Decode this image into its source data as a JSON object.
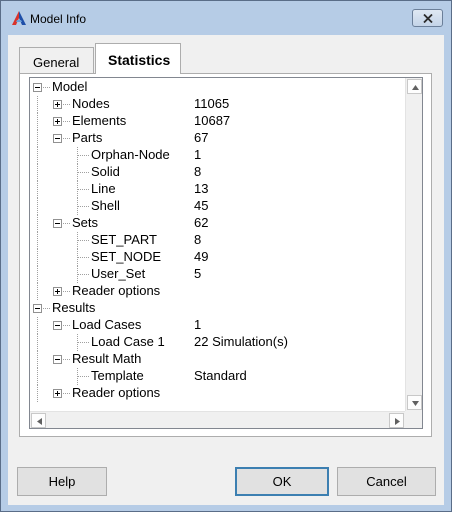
{
  "window": {
    "title": "Model Info",
    "icons": {
      "app": "altair-logo-icon",
      "close": "close-icon"
    }
  },
  "tabs": [
    {
      "label": "General",
      "selected": false
    },
    {
      "label": "Statistics",
      "selected": true
    }
  ],
  "tree": {
    "nodes": [
      {
        "id": "model",
        "label": "Model",
        "value": "",
        "depth": 0,
        "toggle": "minus"
      },
      {
        "id": "nodes",
        "label": "Nodes",
        "value": "11065",
        "depth": 1,
        "toggle": "plus"
      },
      {
        "id": "elements",
        "label": "Elements",
        "value": "10687",
        "depth": 1,
        "toggle": "plus"
      },
      {
        "id": "parts",
        "label": "Parts",
        "value": "67",
        "depth": 1,
        "toggle": "minus"
      },
      {
        "id": "orphan-node",
        "label": "Orphan-Node",
        "value": "1",
        "depth": 2,
        "toggle": "none"
      },
      {
        "id": "solid",
        "label": "Solid",
        "value": "8",
        "depth": 2,
        "toggle": "none"
      },
      {
        "id": "line",
        "label": "Line",
        "value": "13",
        "depth": 2,
        "toggle": "none"
      },
      {
        "id": "shell",
        "label": "Shell",
        "value": "45",
        "depth": 2,
        "toggle": "none"
      },
      {
        "id": "sets",
        "label": "Sets",
        "value": "62",
        "depth": 1,
        "toggle": "minus"
      },
      {
        "id": "set-part",
        "label": "SET_PART",
        "value": "8",
        "depth": 2,
        "toggle": "none"
      },
      {
        "id": "set-node",
        "label": "SET_NODE",
        "value": "49",
        "depth": 2,
        "toggle": "none"
      },
      {
        "id": "user-set",
        "label": "User_Set",
        "value": "5",
        "depth": 2,
        "toggle": "none"
      },
      {
        "id": "model-reader-options",
        "label": "Reader options",
        "value": "",
        "depth": 1,
        "toggle": "plus"
      },
      {
        "id": "results",
        "label": "Results",
        "value": "",
        "depth": 0,
        "toggle": "minus"
      },
      {
        "id": "load-cases",
        "label": "Load Cases",
        "value": "1",
        "depth": 1,
        "toggle": "minus"
      },
      {
        "id": "load-case-1",
        "label": "Load Case 1",
        "value": "22  Simulation(s)",
        "depth": 2,
        "toggle": "none"
      },
      {
        "id": "result-math",
        "label": "Result Math",
        "value": "",
        "depth": 1,
        "toggle": "minus"
      },
      {
        "id": "template",
        "label": "Template",
        "value": "Standard",
        "depth": 2,
        "toggle": "none"
      },
      {
        "id": "results-reader-options",
        "label": "Reader options",
        "value": "",
        "depth": 1,
        "toggle": "plus"
      }
    ]
  },
  "buttons": {
    "help": "Help",
    "ok": "OK",
    "cancel": "Cancel"
  }
}
